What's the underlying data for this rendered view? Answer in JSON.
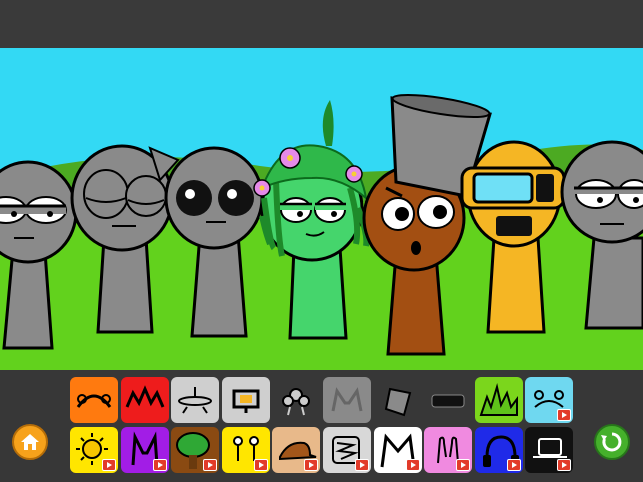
{
  "colors": {
    "sky": "#33d9f4",
    "grass": "#62d21d",
    "hill": "#4caa22",
    "bar": "#383838",
    "home_button": "#f7a21b",
    "reset_button": "#45b02b",
    "video_badge": "#e23b2a"
  },
  "controls": {
    "home_icon": "home-icon",
    "reset_icon": "reset-icon"
  },
  "stage_characters": [
    {
      "name": "gray-sleepy",
      "color": "#8a8a8a"
    },
    {
      "name": "gray-wink",
      "color": "#8a8a8a"
    },
    {
      "name": "gray-dark-eyes",
      "color": "#8a8a8a"
    },
    {
      "name": "green-plant",
      "color": "#45d56c"
    },
    {
      "name": "brown-bucket",
      "color": "#a34f12"
    },
    {
      "name": "yellow-visor",
      "color": "#f5b624"
    },
    {
      "name": "gray-tired",
      "color": "#8a8a8a"
    }
  ],
  "palette_row1": [
    {
      "icon": "orange-hair-icon",
      "bg": "#ff7a0f",
      "video": false
    },
    {
      "icon": "red-spikes-icon",
      "bg": "#ee1c1c",
      "video": false
    },
    {
      "icon": "halo-lines-icon",
      "bg": "#cfcfcf",
      "video": false
    },
    {
      "icon": "monitor-icon",
      "bg": "#cfcfcf",
      "video": false
    },
    {
      "icon": "flower-gray-icon",
      "bg": "transparent",
      "video": false
    },
    {
      "icon": "gray-cat-ears-icon",
      "bg": "#8a8a8a",
      "video": false
    },
    {
      "icon": "gray-bucket-icon",
      "bg": "transparent",
      "video": false
    },
    {
      "icon": "black-visor-icon",
      "bg": "transparent",
      "video": false
    },
    {
      "icon": "green-grass-icon",
      "bg": "#7bd61c",
      "video": false
    },
    {
      "icon": "cyan-antenna-icon",
      "bg": "#6fd8f0",
      "video": true
    }
  ],
  "palette_row2": [
    {
      "icon": "sun-icon",
      "bg": "#ffe600",
      "video": true
    },
    {
      "icon": "purple-ears-icon",
      "bg": "#a21de6",
      "video": true
    },
    {
      "icon": "tree-icon",
      "bg": "#8a4a12",
      "video": true
    },
    {
      "icon": "yellow-antenna-icon",
      "bg": "#ffe600",
      "video": true
    },
    {
      "icon": "cap-icon",
      "bg": "#e8b98a",
      "video": true
    },
    {
      "icon": "scribble-icon",
      "bg": "#d8d8d8",
      "video": true
    },
    {
      "icon": "white-ears-icon",
      "bg": "#ffffff",
      "video": true
    },
    {
      "icon": "pink-bunny-icon",
      "bg": "#f08ae0",
      "video": true
    },
    {
      "icon": "blue-headphones-icon",
      "bg": "#1f2ae8",
      "video": true
    },
    {
      "icon": "black-hat-icon",
      "bg": "#111111",
      "video": true
    }
  ]
}
